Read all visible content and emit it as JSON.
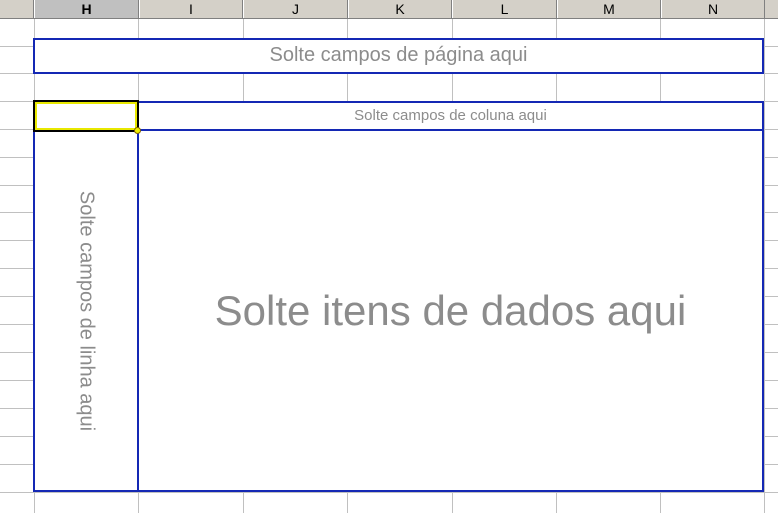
{
  "column_headers": [
    {
      "label": "H",
      "selected": true
    },
    {
      "label": "I",
      "selected": false
    },
    {
      "label": "J",
      "selected": false
    },
    {
      "label": "K",
      "selected": false
    },
    {
      "label": "L",
      "selected": false
    },
    {
      "label": "M",
      "selected": false
    },
    {
      "label": "N",
      "selected": false
    }
  ],
  "pivot": {
    "page_zone_text": "Solte campos de página aqui",
    "column_zone_text": "Solte campos de coluna aqui",
    "row_zone_text": "Solte campos de linha aqui",
    "data_zone_text": "Solte itens de dados aqui"
  },
  "colors": {
    "zone_border": "#1428b4",
    "zone_text": "#8c8c8c",
    "header_bg": "#d4d0c8",
    "gridline": "#c0c0c0",
    "selection_highlight": "#e8e800"
  }
}
